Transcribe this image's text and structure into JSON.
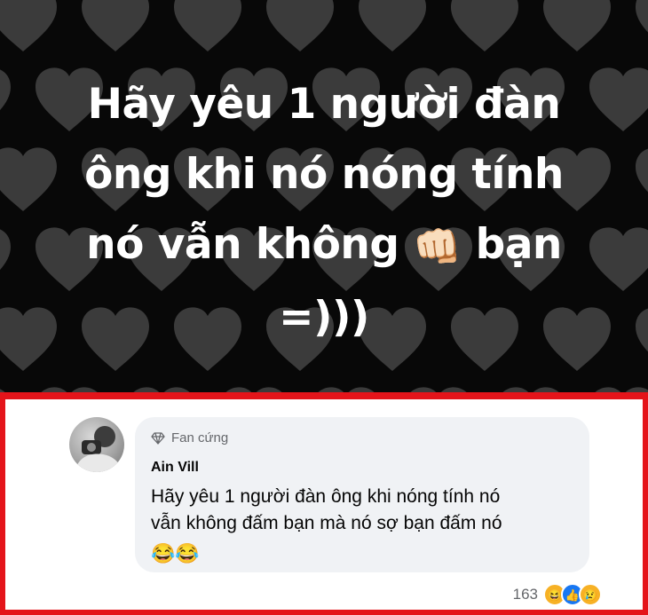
{
  "post": {
    "background": "#080808",
    "heart_color": "#3b3b3b",
    "text_color": "#ffffff",
    "lines": [
      "Hãy yêu 1 người đàn",
      "ông khi nó nóng tính",
      "nó vẫn không",
      "bạn",
      "=)))"
    ],
    "fist_emoji": "👊🏻"
  },
  "comment": {
    "border_color": "#e4141a",
    "badge_icon": "diamond-icon",
    "badge_label": "Fan cứng",
    "author": "Ain Vill",
    "text": "Hãy yêu 1 người đàn ông khi nóng tính nó\nvẫn không đấm bạn mà nó sợ  bạn đấm nó",
    "emojis": "😂😂",
    "reaction_count": "163",
    "reactions": {
      "haha": "😆",
      "like": "👍",
      "sad": "😢"
    }
  }
}
